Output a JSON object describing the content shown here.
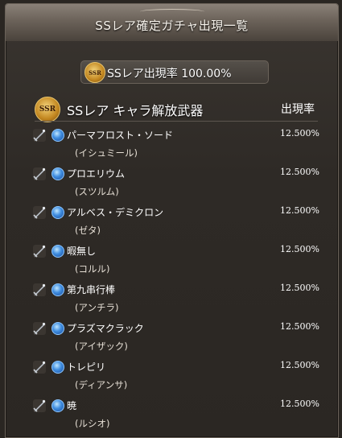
{
  "dialog": {
    "title": "SSレア確定ガチャ出現一覧"
  },
  "rate_summary": {
    "badge_text": "SSR",
    "label": "SSレア出現率 100.00%"
  },
  "section": {
    "badge_text": "SSR",
    "title": "SSレア キャラ解放武器",
    "rate_header": "出現率"
  },
  "items": [
    {
      "weapon": "パーマフロスト・ソード",
      "character": "(イシュミール)",
      "rate": "12.500%",
      "icon": "sword-icon"
    },
    {
      "weapon": "プロエリウム",
      "character": "(スツルム)",
      "rate": "12.500%",
      "icon": "sword-icon"
    },
    {
      "weapon": "アルベス・デミクロン",
      "character": "(ゼタ)",
      "rate": "12.500%",
      "icon": "spear-icon"
    },
    {
      "weapon": "暇無し",
      "character": "(コルル)",
      "rate": "12.500%",
      "icon": "dagger-icon"
    },
    {
      "weapon": "第九串行棒",
      "character": "(アンチラ)",
      "rate": "12.500%",
      "icon": "staff-icon"
    },
    {
      "weapon": "プラズマクラック",
      "character": "(アイザック)",
      "rate": "12.500%",
      "icon": "axe-icon"
    },
    {
      "weapon": "トレピリ",
      "character": "(ディアンサ)",
      "rate": "12.500%",
      "icon": "harp-icon"
    },
    {
      "weapon": "暁",
      "character": "(ルシオ)",
      "rate": "12.500%",
      "icon": "crossed-swords-icon"
    }
  ]
}
